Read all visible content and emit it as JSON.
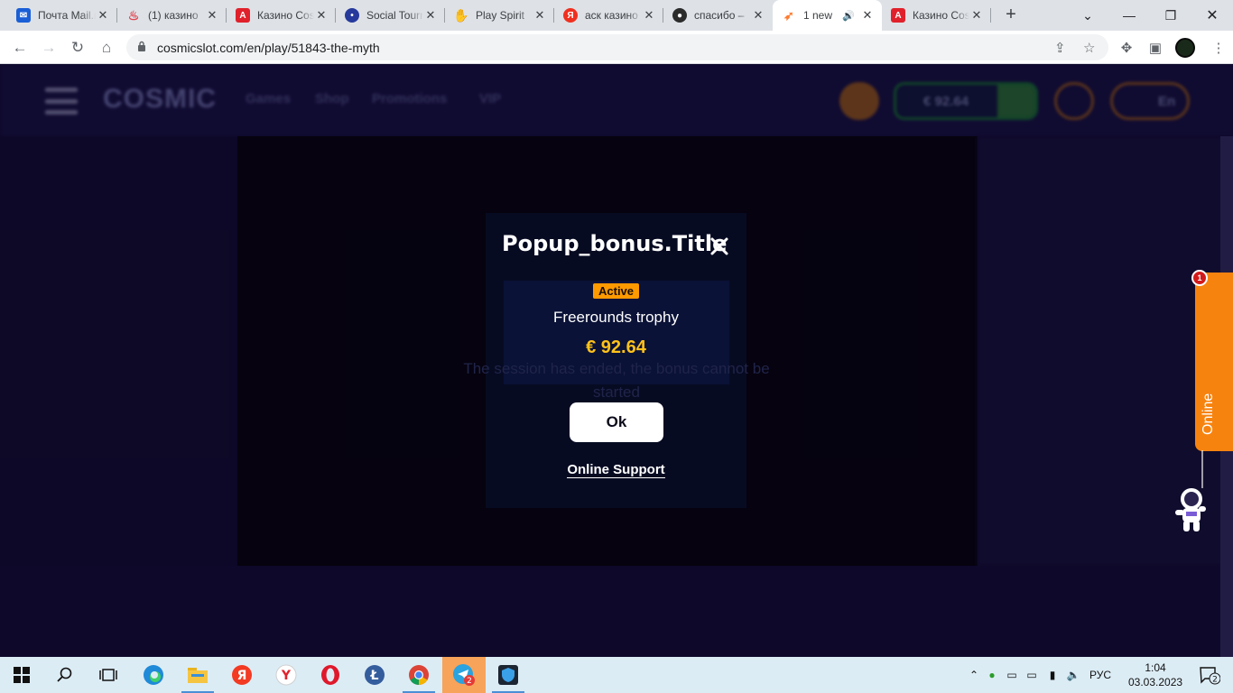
{
  "browser": {
    "tabs": [
      {
        "label": "Почта Mail.ru",
        "favicon_color": "#1a5fd6",
        "icon": "mail-icon"
      },
      {
        "label": "(1) казино",
        "favicon_color": "#e0444f",
        "icon": "bowl-icon"
      },
      {
        "label": "Казино Cosmic",
        "favicon_color": "#e0212b",
        "icon": "a-logo-icon"
      },
      {
        "label": "Social Tournaments",
        "favicon_color": "#263a9c",
        "icon": "globe-icon"
      },
      {
        "label": "Play Spirit",
        "favicon_color": "#f2a35a",
        "icon": "hand-icon"
      },
      {
        "label": "аск казино",
        "favicon_color": "#f0301f",
        "icon": "yandex-icon"
      },
      {
        "label": "спасибо – ",
        "favicon_color": "#2b2b2b",
        "icon": "avatar-icon"
      },
      {
        "label": "1 new",
        "favicon_color": "#ff7b2e",
        "icon": "rocket-icon",
        "active": true
      },
      {
        "label": "Казино Cosmic",
        "favicon_color": "#e0212b",
        "icon": "a-logo-icon"
      }
    ],
    "url": "cosmicslot.com/en/play/51843-the-myth"
  },
  "site": {
    "logo": "COSMIC",
    "nav": [
      "Games",
      "Shop",
      "Promotions",
      "VIP"
    ],
    "balance": "€ 92.64",
    "lang": "En"
  },
  "popup": {
    "title": "Popup_bonus.Title",
    "status_badge": "Active",
    "bonus_name": "Freerounds trophy",
    "bonus_amount": "€ 92.64",
    "ok_label": "Ok",
    "support_label": "Online Support",
    "ghost_line1": "The session has ended, the bonus cannot be",
    "ghost_line2": "started"
  },
  "online_widget": {
    "label": "Online",
    "notification_count": "1"
  },
  "taskbar": {
    "lang": "РУС",
    "time": "1:04",
    "date": "03.03.2023",
    "telegram_badge": "2",
    "notifications_badge": "2"
  },
  "colors": {
    "page_bg": "#120c33",
    "accent_orange": "#f7830f",
    "amount_gold": "#ffc21a",
    "badge_orange": "#ff9900"
  }
}
